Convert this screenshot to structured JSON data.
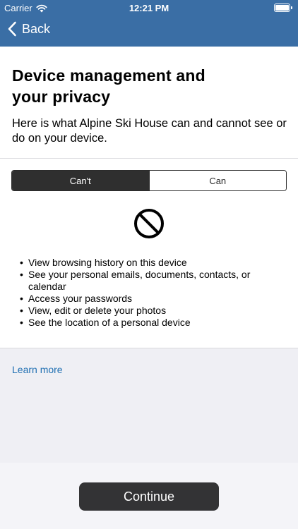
{
  "status_bar": {
    "carrier": "Carrier",
    "time": "12:21 PM",
    "icons": [
      "wifi-icon",
      "battery-icon"
    ]
  },
  "nav": {
    "back_label": "Back",
    "back_icon": "chevron-left-icon"
  },
  "content": {
    "title_line1": "Device management and",
    "title_line2": "your privacy",
    "subtitle": "Here is what Alpine Ski House can and cannot see or do on your device.",
    "segments": [
      {
        "label": "Can't",
        "selected": true
      },
      {
        "label": "Can",
        "selected": false
      }
    ],
    "status_icon": "prohibited-icon",
    "items": [
      "View browsing history on this device",
      "See your personal emails, documents, contacts, or calendar",
      "Access your passwords",
      "View, edit or delete your photos",
      "See the location of a personal device"
    ]
  },
  "learn_more": "Learn more",
  "footer": {
    "continue_label": "Continue"
  },
  "colors": {
    "nav_bar": "#3a6ea5",
    "link": "#1f6fb2",
    "segment_active": "#2f2f2f",
    "button": "#333335",
    "background": "#efeff4"
  }
}
